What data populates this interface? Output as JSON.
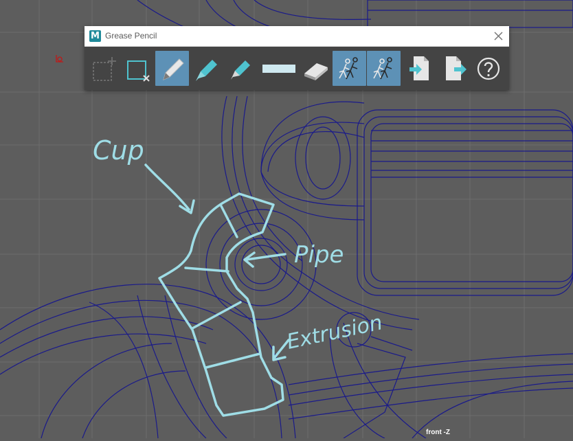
{
  "window": {
    "title": "Grease Pencil",
    "app_icon_letter": "M",
    "app_icon": "maya-logo-icon",
    "close_icon": "close-icon"
  },
  "toolbar": {
    "tools": [
      {
        "name": "add-frame",
        "icon": "add-frame-icon",
        "active": false
      },
      {
        "name": "remove-frame",
        "icon": "remove-frame-icon",
        "active": false
      },
      {
        "name": "pencil",
        "icon": "pencil-icon",
        "active": true
      },
      {
        "name": "marker",
        "icon": "marker-icon",
        "active": false
      },
      {
        "name": "soft-pencil",
        "icon": "soft-pencil-icon",
        "active": false
      },
      {
        "name": "brush-size",
        "icon": "brush-size-slider-icon",
        "active": false
      },
      {
        "name": "eraser",
        "icon": "eraser-icon",
        "active": false
      },
      {
        "name": "ghost-previous",
        "icon": "ghost-previous-frame-icon",
        "active": true
      },
      {
        "name": "ghost-next",
        "icon": "ghost-next-frame-icon",
        "active": true
      },
      {
        "name": "import",
        "icon": "import-icon",
        "active": false
      },
      {
        "name": "export",
        "icon": "export-icon",
        "active": false
      },
      {
        "name": "help",
        "icon": "help-icon",
        "active": false
      }
    ]
  },
  "viewport": {
    "camera_label": "front -Z",
    "annotations": [
      "Cup",
      "Pipe",
      "Extrusion"
    ]
  },
  "colors": {
    "viewport_bg": "#5d5d5d",
    "grid_line": "#6a6a6a",
    "wireframe": "#1a1a8a",
    "sketch": "#9fdde6",
    "toolbar_bg": "#444444",
    "active_tool": "#5d91b6",
    "tool_accent": "#4fc3cf"
  }
}
